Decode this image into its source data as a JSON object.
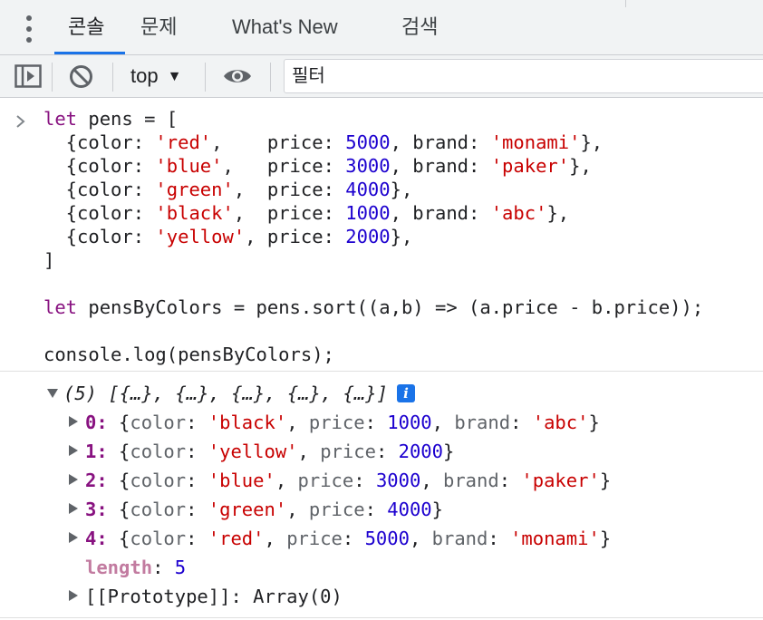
{
  "tabs": {
    "items": [
      {
        "label": "콘솔",
        "active": true
      },
      {
        "label": "문제"
      },
      {
        "label": "What's New"
      },
      {
        "label": "검색"
      }
    ]
  },
  "toolbar": {
    "context": "top",
    "filter_placeholder": "필터"
  },
  "icons": {
    "menu": "more-vert-icon",
    "sidebar": "sidebar-toggle-icon",
    "clear": "clear-console-icon",
    "dropdown": "chevron-down-icon",
    "eye": "live-expression-eye-icon",
    "prompt": "prompt-chevron-icon",
    "info": "info-icon"
  },
  "console": {
    "input_lines": [
      "let pens = [",
      "  {color: 'red',    price: 5000, brand: 'monami'},",
      "  {color: 'blue',   price: 3000, brand: 'paker'},",
      "  {color: 'green',  price: 4000},",
      "  {color: 'black',  price: 1000, brand: 'abc'},",
      "  {color: 'yellow', price: 2000},",
      "]",
      "",
      "let pensByColors = pens.sort((a,b) => (a.price - b.price));",
      "",
      "console.log(pensByColors);"
    ],
    "output": {
      "summary": "(5) [{…}, {…}, {…}, {…}, {…}]",
      "entries": [
        {
          "index": "0",
          "color": "'black'",
          "price": "1000",
          "brand": "'abc'"
        },
        {
          "index": "1",
          "color": "'yellow'",
          "price": "2000"
        },
        {
          "index": "2",
          "color": "'blue'",
          "price": "3000",
          "brand": "'paker'"
        },
        {
          "index": "3",
          "color": "'green'",
          "price": "4000"
        },
        {
          "index": "4",
          "color": "'red'",
          "price": "5000",
          "brand": "'monami'"
        }
      ],
      "length_key": "length",
      "length_value": "5",
      "prototype": "[[Prototype]]: Array(0)"
    }
  },
  "colors": {
    "keyword": "#881280",
    "string": "#c80000",
    "number": "#1c00cf",
    "accent": "#1a73e8"
  }
}
